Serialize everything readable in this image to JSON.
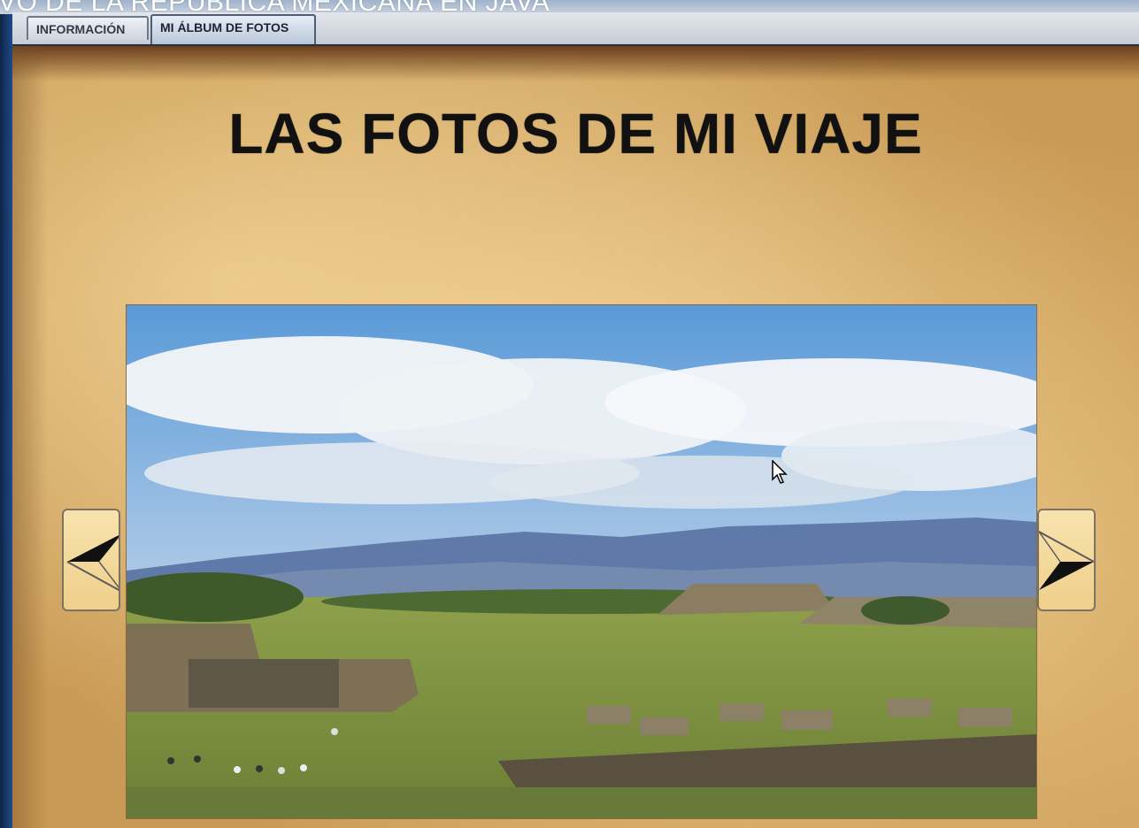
{
  "window": {
    "title": "VO DE LA REPÚBLICA MEXICANA EN JAVA"
  },
  "tabs": [
    {
      "label": "INFORMACIÓN",
      "selected": false
    },
    {
      "label": "MI ÁLBUM DE FOTOS",
      "selected": true
    }
  ],
  "album": {
    "heading": "LAS FOTOS DE MI VIAJE",
    "photo_alt": "Ruinas arqueológicas con cielo nublado y montañas",
    "prev_icon": "arrow-left-icon",
    "next_icon": "arrow-right-icon"
  },
  "colors": {
    "tab_border": "#6d7888",
    "heading": "#111111",
    "parchment": "#e8c68a",
    "button": "#f8e3ad"
  }
}
